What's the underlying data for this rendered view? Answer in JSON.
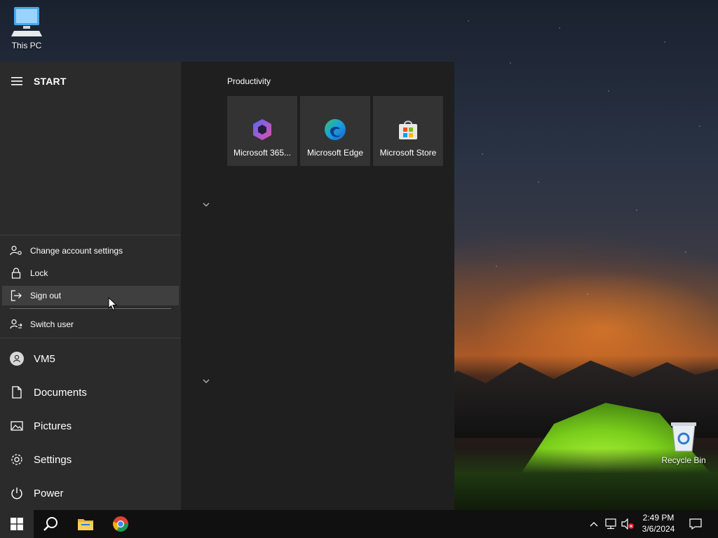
{
  "desktop": {
    "icons": [
      {
        "label": "This PC"
      },
      {
        "label": "Recycle Bin"
      }
    ]
  },
  "start_menu": {
    "title": "START",
    "tile_group": {
      "title": "Productivity",
      "tiles": [
        {
          "label": "Microsoft 365..."
        },
        {
          "label": "Microsoft Edge"
        },
        {
          "label": "Microsoft Store"
        }
      ]
    },
    "account_flyout": {
      "items": [
        {
          "label": "Change account settings",
          "icon": "person-gear-icon"
        },
        {
          "label": "Lock",
          "icon": "lock-icon"
        },
        {
          "label": "Sign out",
          "icon": "sign-out-icon",
          "hovered": true
        },
        {
          "label": "Switch user",
          "icon": "switch-user-icon"
        }
      ]
    },
    "rail": [
      {
        "label": "VM5",
        "icon": "user-avatar-icon"
      },
      {
        "label": "Documents",
        "icon": "document-icon"
      },
      {
        "label": "Pictures",
        "icon": "pictures-icon"
      },
      {
        "label": "Settings",
        "icon": "gear-icon"
      },
      {
        "label": "Power",
        "icon": "power-icon"
      }
    ]
  },
  "taskbar": {
    "pinned": [
      {
        "name": "Start",
        "icon": "windows-logo-icon"
      },
      {
        "name": "Search",
        "icon": "search-icon"
      },
      {
        "name": "File Explorer",
        "icon": "folder-icon"
      },
      {
        "name": "Google Chrome",
        "icon": "chrome-icon"
      }
    ],
    "clock": {
      "time": "2:49 PM",
      "date": "3/6/2024"
    }
  },
  "colors": {
    "start_left": "#2b2b2b",
    "start_right": "#1f1f1f",
    "tile": "#333333",
    "hover": "#3f3f3f",
    "taskbar": "#101010"
  }
}
